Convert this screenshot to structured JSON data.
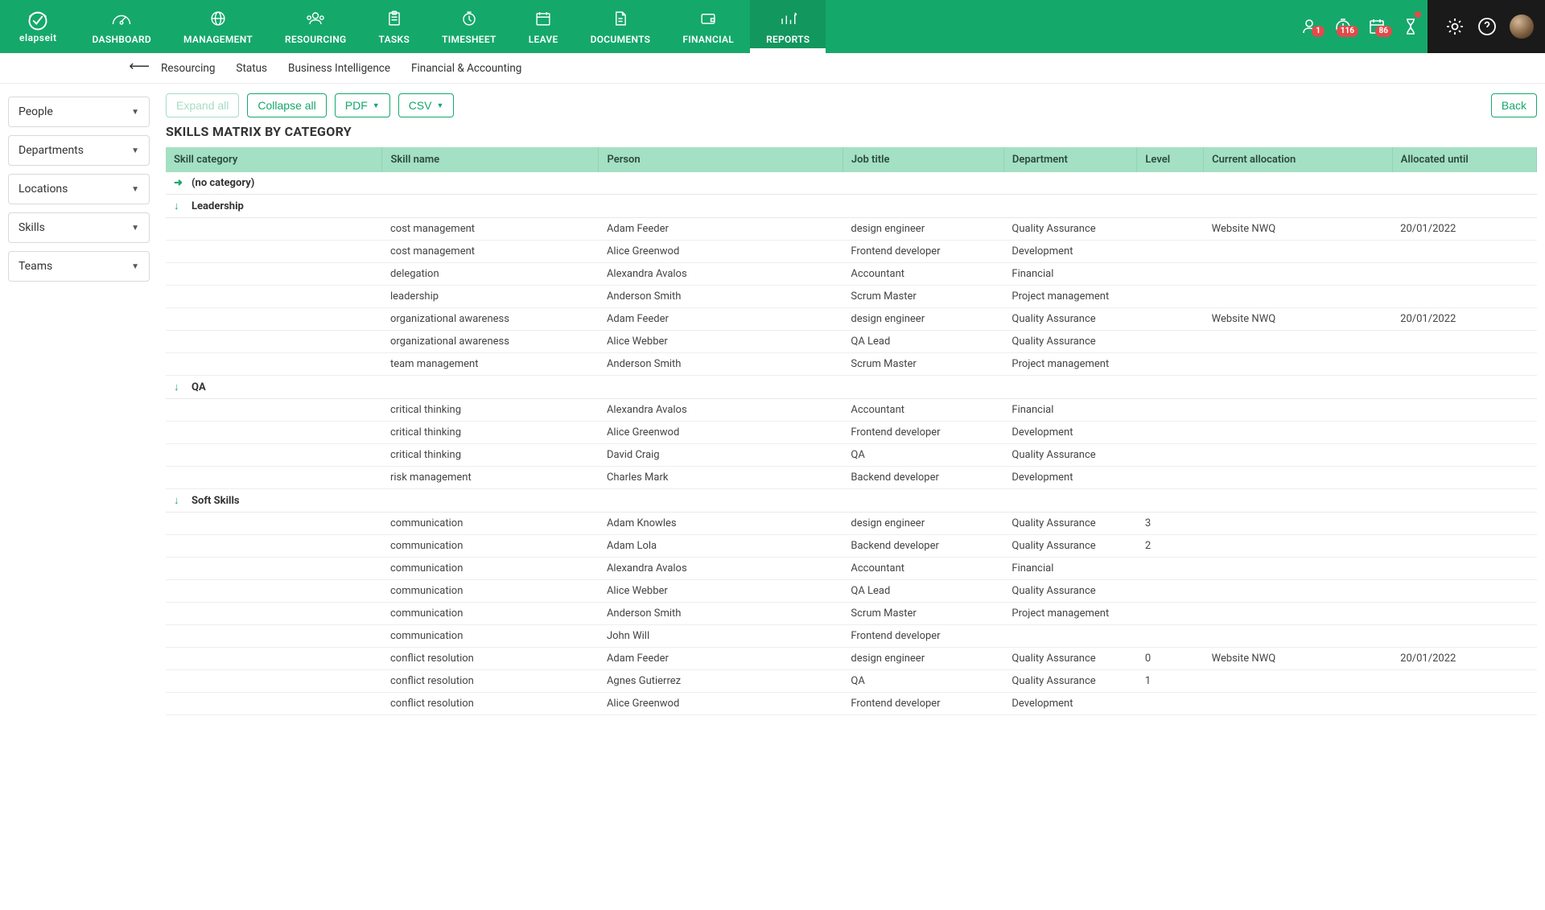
{
  "brand": "elapseit",
  "nav": {
    "items": [
      {
        "label": "DASHBOARD"
      },
      {
        "label": "MANAGEMENT"
      },
      {
        "label": "RESOURCING"
      },
      {
        "label": "TASKS"
      },
      {
        "label": "TIMESHEET"
      },
      {
        "label": "LEAVE"
      },
      {
        "label": "DOCUMENTS"
      },
      {
        "label": "FINANCIAL"
      },
      {
        "label": "REPORTS"
      }
    ],
    "badges": {
      "b1": "1",
      "b2": "116",
      "b3": "86"
    }
  },
  "subnav": {
    "t1": "Resourcing",
    "t2": "Status",
    "t3": "Business Intelligence",
    "t4": "Financial & Accounting"
  },
  "filters": {
    "f1": "People",
    "f2": "Departments",
    "f3": "Locations",
    "f4": "Skills",
    "f5": "Teams"
  },
  "toolbar": {
    "expand": "Expand all",
    "collapse": "Collapse all",
    "pdf": "PDF",
    "csv": "CSV",
    "back": "Back"
  },
  "title": "SKILLS MATRIX BY CATEGORY",
  "columns": {
    "c1": "Skill category",
    "c2": "Skill name",
    "c3": "Person",
    "c4": "Job title",
    "c5": "Department",
    "c6": "Level",
    "c7": "Current allocation",
    "c8": "Allocated until"
  },
  "groups": [
    {
      "name": "(no category)",
      "collapsed": true,
      "rows": []
    },
    {
      "name": "Leadership",
      "collapsed": false,
      "rows": [
        {
          "skill": "cost management",
          "person": "Adam Feeder",
          "job": "design engineer",
          "dept": "Quality Assurance",
          "level": "",
          "alloc": "Website NWQ",
          "until": "20/01/2022"
        },
        {
          "skill": "cost management",
          "person": "Alice Greenwod",
          "job": "Frontend developer",
          "dept": "Development",
          "level": "",
          "alloc": "",
          "until": ""
        },
        {
          "skill": "delegation",
          "person": "Alexandra Avalos",
          "job": "Accountant",
          "dept": "Financial",
          "level": "",
          "alloc": "",
          "until": ""
        },
        {
          "skill": "leadership",
          "person": "Anderson Smith",
          "job": "Scrum Master",
          "dept": "Project management",
          "level": "",
          "alloc": "",
          "until": ""
        },
        {
          "skill": "organizational awareness",
          "person": "Adam Feeder",
          "job": "design engineer",
          "dept": "Quality Assurance",
          "level": "",
          "alloc": "Website NWQ",
          "until": "20/01/2022"
        },
        {
          "skill": "organizational awareness",
          "person": "Alice Webber",
          "job": "QA Lead",
          "dept": "Quality Assurance",
          "level": "",
          "alloc": "",
          "until": ""
        },
        {
          "skill": "team management",
          "person": "Anderson Smith",
          "job": "Scrum Master",
          "dept": "Project management",
          "level": "",
          "alloc": "",
          "until": ""
        }
      ]
    },
    {
      "name": "QA",
      "collapsed": false,
      "rows": [
        {
          "skill": "critical thinking",
          "person": "Alexandra Avalos",
          "job": "Accountant",
          "dept": "Financial",
          "level": "",
          "alloc": "",
          "until": ""
        },
        {
          "skill": "critical thinking",
          "person": "Alice Greenwod",
          "job": "Frontend developer",
          "dept": "Development",
          "level": "",
          "alloc": "",
          "until": ""
        },
        {
          "skill": "critical thinking",
          "person": "David Craig",
          "job": "QA",
          "dept": "Quality Assurance",
          "level": "",
          "alloc": "",
          "until": ""
        },
        {
          "skill": "risk management",
          "person": "Charles Mark",
          "job": "Backend developer",
          "dept": "Development",
          "level": "",
          "alloc": "",
          "until": ""
        }
      ]
    },
    {
      "name": "Soft Skills",
      "collapsed": false,
      "rows": [
        {
          "skill": "communication",
          "person": "Adam Knowles",
          "job": "design engineer",
          "dept": "Quality Assurance",
          "level": "3",
          "alloc": "",
          "until": ""
        },
        {
          "skill": "communication",
          "person": "Adam Lola",
          "job": "Backend developer",
          "dept": "Quality Assurance",
          "level": "2",
          "alloc": "",
          "until": ""
        },
        {
          "skill": "communication",
          "person": "Alexandra Avalos",
          "job": "Accountant",
          "dept": "Financial",
          "level": "",
          "alloc": "",
          "until": ""
        },
        {
          "skill": "communication",
          "person": "Alice Webber",
          "job": "QA Lead",
          "dept": "Quality Assurance",
          "level": "",
          "alloc": "",
          "until": ""
        },
        {
          "skill": "communication",
          "person": "Anderson Smith",
          "job": "Scrum Master",
          "dept": "Project management",
          "level": "",
          "alloc": "",
          "until": ""
        },
        {
          "skill": "communication",
          "person": "John Will",
          "job": "Frontend developer",
          "dept": "",
          "level": "",
          "alloc": "",
          "until": ""
        },
        {
          "skill": "conflict resolution",
          "person": "Adam Feeder",
          "job": "design engineer",
          "dept": "Quality Assurance",
          "level": "0",
          "alloc": "Website NWQ",
          "until": "20/01/2022"
        },
        {
          "skill": "conflict resolution",
          "person": "Agnes Gutierrez",
          "job": "QA",
          "dept": "Quality Assurance",
          "level": "1",
          "alloc": "",
          "until": ""
        },
        {
          "skill": "conflict resolution",
          "person": "Alice Greenwod",
          "job": "Frontend developer",
          "dept": "Development",
          "level": "",
          "alloc": "",
          "until": ""
        }
      ]
    }
  ]
}
